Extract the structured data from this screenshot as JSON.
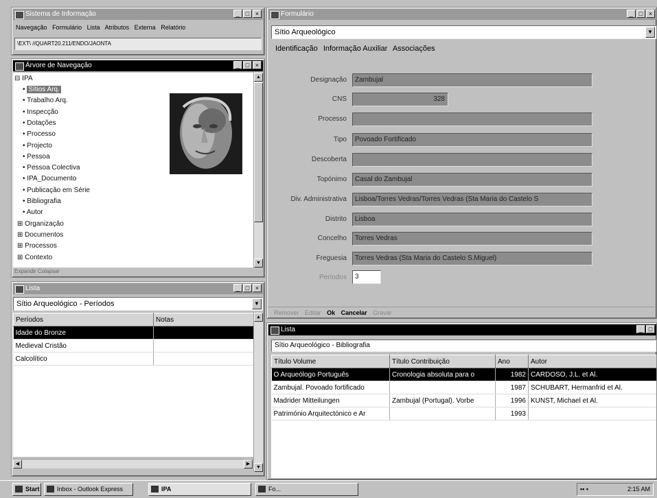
{
  "sysinfo": {
    "title": "Sistema de Informação",
    "menu": [
      "Navegação",
      "Formulário",
      "Lista",
      "Atributos",
      "Externa",
      "Relatório"
    ],
    "path": "\\EXT\\ //QUART20.211/ENDO/JAONTA"
  },
  "tree": {
    "title": "Árvore de Navegação",
    "root": "IPA",
    "items": [
      "Sítios Arq.",
      "Trabalho Arq.",
      "Inspecção",
      "Dotações",
      "Processo",
      "Projecto",
      "Pessoa",
      "Pessoa Colectiva",
      "IPA_Documento",
      "Publicação em Série",
      "Bibliografia",
      "Autor"
    ],
    "groups": [
      "Organização",
      "Documentos",
      "Processos",
      "Contexto"
    ],
    "footer": "Expandir   Colapsar"
  },
  "list1": {
    "title": "Lista",
    "combo": "Sítio Arqueológico - Períodos",
    "columns": [
      "Períodos",
      "Notas"
    ],
    "rows": [
      "Idade do Bronze",
      "Medieval Cristão",
      "Calcolítico"
    ]
  },
  "form": {
    "title": "Formulário",
    "combo": "Sítio Arqueológico",
    "tabs": [
      "Identificação",
      "Informação Auxiliar",
      "Associações"
    ],
    "labels": {
      "designacao": "Designação",
      "cns": "CNS",
      "processo": "Processo",
      "tipo": "Tipo",
      "descoberta": "Descoberta",
      "toponimo": "Topónimo",
      "div": "Div. Administrativa",
      "distrito": "Distrito",
      "concelho": "Concelho",
      "freguesia": "Freguesia",
      "periodos": "Períodos"
    },
    "values": {
      "designacao": "Zambujal",
      "cns": "328",
      "processo": "",
      "tipo": "Povoado Fortificado",
      "descoberta": "",
      "toponimo": "Casal do Zambujal",
      "div": "Lisboa/Torres Vedras/Torres Vedras (Sta Maria do Castelo S",
      "distrito": "Lisboa",
      "concelho": "Torres Vedras",
      "freguesia": "Torres Vedras (Sta Maria do Castelo S.Miguel)",
      "periodos": "3"
    },
    "buttons": {
      "remove": "Remover",
      "edit": "Editar",
      "ok": "Ok",
      "cancel": "Cancelar",
      "save": "Gravar"
    }
  },
  "list2": {
    "title": "Lista",
    "combo": "Sítio Arqueológico - Bibliografia",
    "columns": [
      "Título Volume",
      "Título Contribuição",
      "Ano",
      "Autor"
    ],
    "rows": [
      [
        "O Arqueólogo Português",
        "Cronologia absoluta para o",
        "1982",
        "CARDOSO, J.L. et Al."
      ],
      [
        "Zambujal. Povoado fortificado",
        "",
        "1987",
        "SCHUBART, Hermanfrid et Al."
      ],
      [
        "Madrider Mitteilungen",
        "Zambujal (Portugal). Vorbe",
        "1996",
        "KUNST, Michael et Al."
      ],
      [
        "Património Arquitectónico e Ar",
        "",
        "1993",
        ""
      ]
    ]
  },
  "taskbar": {
    "start": "Start",
    "buttons": [
      "Inbox - Outlook Express",
      "IPA",
      "Fo..."
    ],
    "time": "2:15 AM"
  },
  "colors": {
    "selection": "#000000",
    "field": "#8c8c8c",
    "active_title": "#000000"
  }
}
